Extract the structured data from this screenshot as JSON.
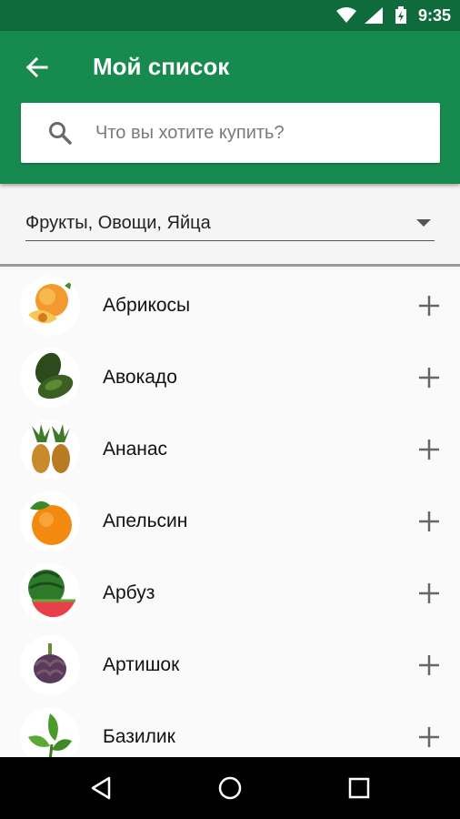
{
  "status_bar": {
    "time": "9:35"
  },
  "toolbar": {
    "title": "Мой список",
    "search_placeholder": "Что вы хотите купить?",
    "color": "#178a4f"
  },
  "category": {
    "selected": "Фрукты, Овощи, Яйца"
  },
  "items": [
    {
      "name": "Абрикосы",
      "icon": "apricot-icon"
    },
    {
      "name": "Авокадо",
      "icon": "avocado-icon"
    },
    {
      "name": "Ананас",
      "icon": "pineapple-icon"
    },
    {
      "name": "Апельсин",
      "icon": "orange-icon"
    },
    {
      "name": "Арбуз",
      "icon": "watermelon-icon"
    },
    {
      "name": "Артишок",
      "icon": "artichoke-icon"
    },
    {
      "name": "Базилик",
      "icon": "basil-icon"
    }
  ]
}
